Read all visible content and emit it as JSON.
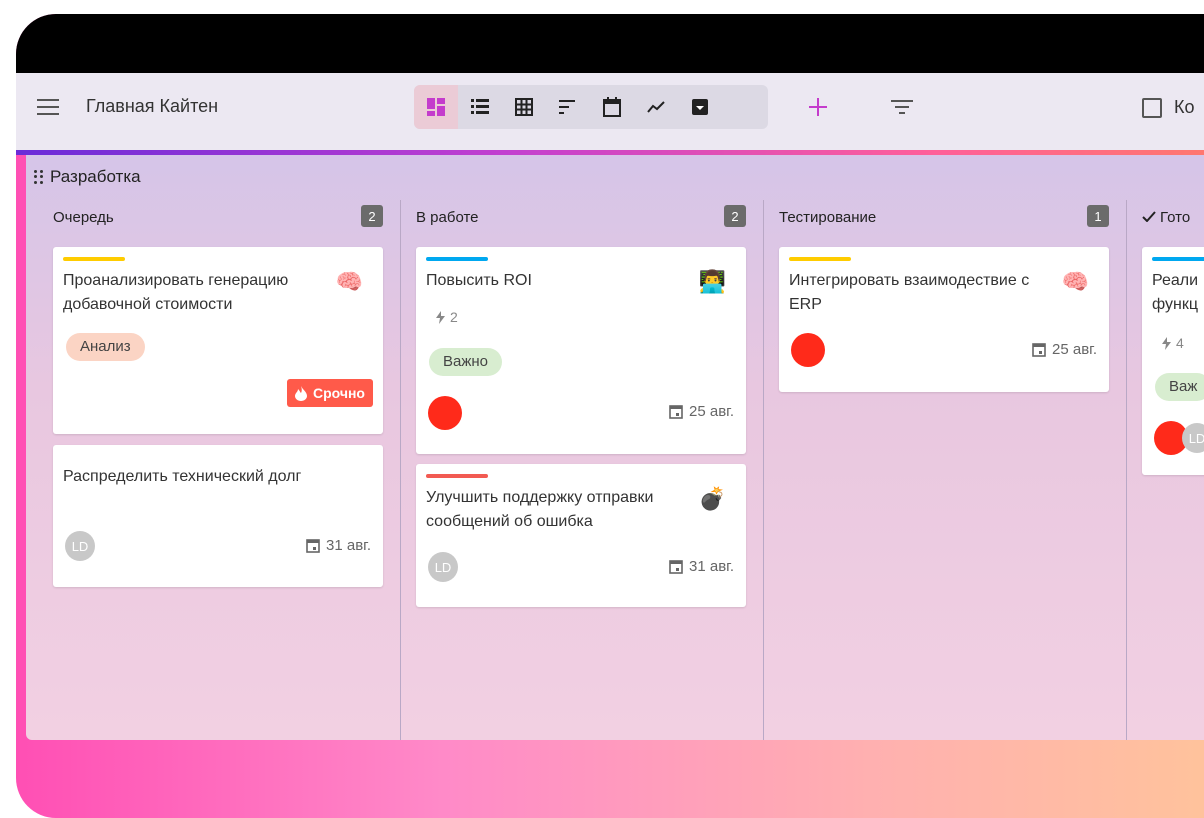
{
  "header": {
    "board_title": "Главная Кайтен",
    "checkbox_label": "Ко"
  },
  "space": {
    "title": "Разработка"
  },
  "columns": [
    {
      "title": "Очередь",
      "count": "2",
      "cards": [
        {
          "title": "Проанализировать генерацию добавочной стоимости",
          "bar_color": "#ffcc00",
          "emoji": "🧠",
          "tag": "Анализ",
          "tag_color": "#fbd4c4",
          "urgent": "Срочно"
        },
        {
          "title": "Распределить технический долг",
          "avatar": "LD",
          "date": "31 авг."
        }
      ]
    },
    {
      "title": "В работе",
      "count": "2",
      "cards": [
        {
          "title": "Повысить ROI",
          "bar_color": "#00a8f0",
          "emoji": "👨‍💻",
          "size": "2",
          "tag": "Важно",
          "tag_color": "#d8edd0",
          "date": "25 авг."
        },
        {
          "title": "Улучшить поддержку отправки сообщений об ошибка",
          "bar_color": "#f25a52",
          "emoji": "💣",
          "avatar": "LD",
          "date": "31 авг."
        }
      ]
    },
    {
      "title": "Тестирование",
      "count": "1",
      "cards": [
        {
          "title": "Интегрировать взаимодествие с ERP",
          "bar_color": "#ffcc00",
          "emoji": "🧠",
          "date": "25 авг."
        }
      ]
    },
    {
      "title": "Гото",
      "cards": [
        {
          "title": "Реали функц",
          "bar_color": "#00a8f0",
          "size": "4",
          "tag": "Важ",
          "tag_color": "#d8edd0",
          "avatar": "LD"
        }
      ]
    }
  ],
  "colors": {
    "accent_purple": "#c43ccc",
    "avatar_red": "#ff2a1a",
    "urgent_red": "#ff5a4a"
  },
  "icons": [
    "menu-icon",
    "board-view-icon",
    "list-view-icon",
    "table-view-icon",
    "timeline-view-icon",
    "calendar-view-icon",
    "chart-view-icon",
    "archive-icon",
    "add-icon",
    "filter-icon",
    "drag-handle-icon",
    "calendar-icon",
    "lightning-icon",
    "fire-icon",
    "check-icon"
  ]
}
